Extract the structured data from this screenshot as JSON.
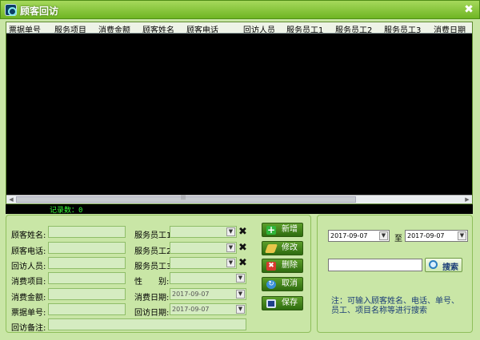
{
  "window": {
    "title": "顾客回访",
    "close_glyph": "✖"
  },
  "grid": {
    "columns": [
      "票据单号",
      "服务项目",
      "消费金额",
      "顾客姓名",
      "顾客电话",
      "回访人员",
      "服务员工1",
      "服务员工2",
      "服务员工3",
      "消费日期"
    ],
    "rows": []
  },
  "record_count": "记录数：0",
  "form": {
    "customer_name_label": "顾客姓名:",
    "customer_name_value": "",
    "customer_phone_label": "顾客电话:",
    "customer_phone_value": "",
    "visitor_label": "回访人员:",
    "visitor_value": "",
    "item_label": "消费项目:",
    "item_value": "",
    "amount_label": "消费金额:",
    "amount_value": "",
    "ticket_label": "票据单号:",
    "ticket_value": "",
    "remark_label": "回访备注:",
    "remark_value": "",
    "staff1_label": "服务员工1",
    "staff1_value": "",
    "staff2_label": "服务员工2",
    "staff2_value": "",
    "staff3_label": "服务员工3",
    "staff3_value": "",
    "gender_label": "性　　别:",
    "gender_value": "",
    "consume_date_label": "消费日期:",
    "consume_date_value": "2017-09-07",
    "visit_date_label": "回访日期:",
    "visit_date_value": "2017-09-07"
  },
  "buttons": {
    "add": "新增",
    "edit": "修改",
    "delete": "删除",
    "cancel": "取消",
    "save": "保存"
  },
  "search": {
    "date_from": "2017-09-07",
    "to_label": "至",
    "date_to": "2017-09-07",
    "query_value": "",
    "button_label": "搜索",
    "note": "注：可输入顾客姓名、电话、单号、员工、项目名称等进行搜索"
  },
  "colors": {
    "titlebar": "#7cc42e",
    "panel_bg": "#c9e6a6",
    "button_green": "#3f7f1a",
    "record_text": "#39ff39",
    "note_text": "#1a3c77"
  },
  "icons": {
    "add": "plus-icon",
    "edit": "edit-icon",
    "delete": "delete-icon",
    "cancel": "refresh-icon",
    "save": "save-icon",
    "search": "magnifier-icon"
  }
}
